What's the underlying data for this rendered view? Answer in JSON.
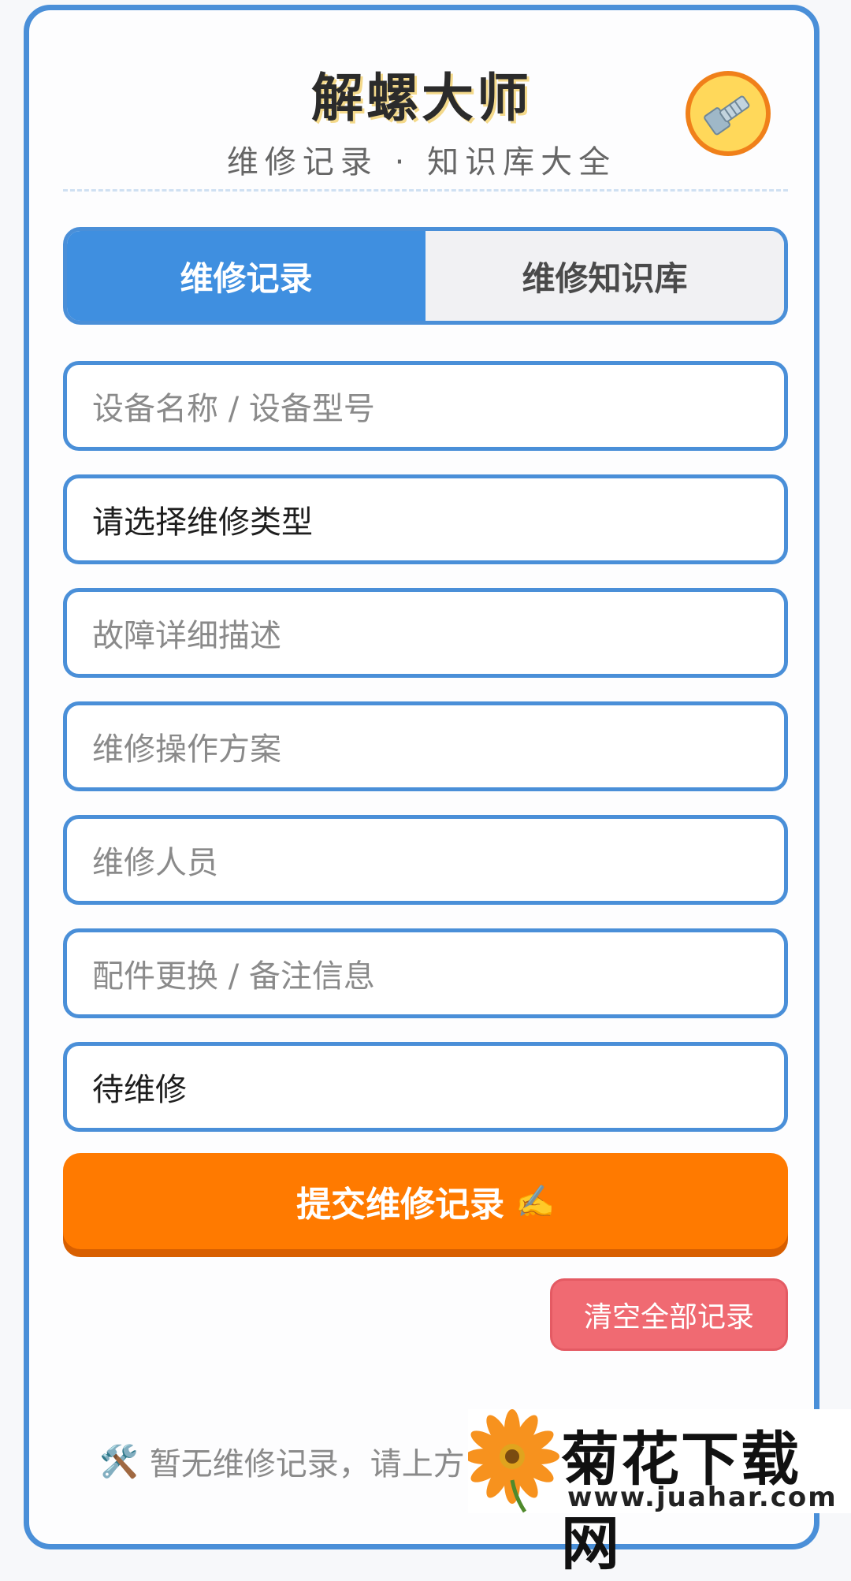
{
  "header": {
    "title": "解螺大师",
    "subtitle": "维修记录 · 知识库大全",
    "logo_icon": "bolt-icon"
  },
  "tabs": [
    {
      "label": "维修记录",
      "active": true
    },
    {
      "label": "维修知识库",
      "active": false
    }
  ],
  "form": {
    "device_placeholder": "设备名称 / 设备型号",
    "repair_type_value": "请选择维修类型",
    "fault_placeholder": "故障详细描述",
    "plan_placeholder": "维修操作方案",
    "staff_placeholder": "维修人员",
    "notes_placeholder": "配件更换 / 备注信息",
    "status_value": "待维修"
  },
  "actions": {
    "submit_label": "提交维修记录",
    "submit_emoji": "✍️",
    "clear_label": "清空全部记录"
  },
  "empty_state": {
    "icon": "tools-icon",
    "icon_glyph": "🛠️",
    "text": "暂无维修记录，请上方"
  },
  "watermark": {
    "text": "菊花下载网",
    "url": "www.juahar.com"
  },
  "colors": {
    "accent_blue": "#4a8fd8",
    "tab_active": "#3f8fe0",
    "submit_orange": "#ff7a00",
    "clear_red": "#f06a72"
  }
}
